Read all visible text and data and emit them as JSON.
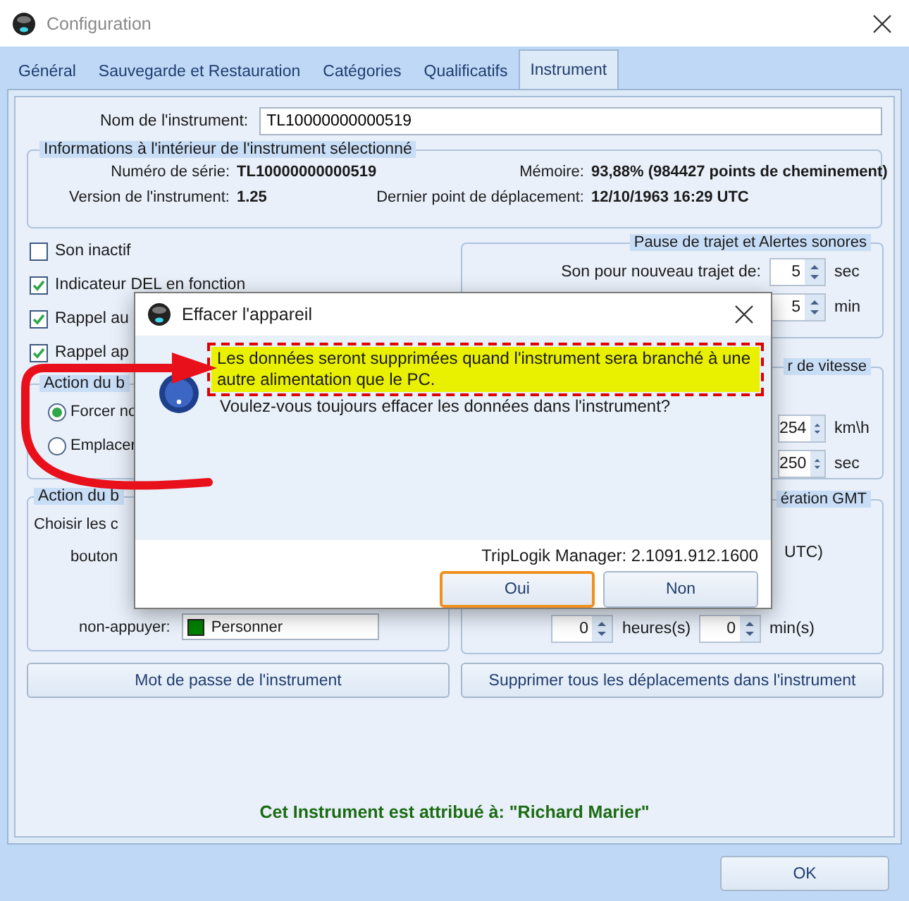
{
  "window": {
    "title": "Configuration"
  },
  "tabs": [
    {
      "label": "Général",
      "selected": false
    },
    {
      "label": "Sauvegarde et Restauration",
      "selected": false
    },
    {
      "label": "Catégories",
      "selected": false
    },
    {
      "label": "Qualificatifs",
      "selected": false
    },
    {
      "label": "Instrument",
      "selected": true
    }
  ],
  "instrument_name": {
    "label": "Nom de l'instrument:",
    "value": "TL10000000000519"
  },
  "info_group": {
    "title": "Informations à l'intérieur de l'instrument sélectionné",
    "fields": [
      {
        "label": "Numéro de série:",
        "value": "TL10000000000519"
      },
      {
        "label": "Mémoire:",
        "value": "93,88% (984427 points de cheminement)"
      },
      {
        "label": "Version de l'instrument:",
        "value": "1.25"
      },
      {
        "label": "Dernier point de déplacement:",
        "value": "12/10/1963 16:29 UTC"
      }
    ]
  },
  "options": [
    {
      "label": "Son inactif",
      "checked": false
    },
    {
      "label": "Indicateur DEL en fonction",
      "checked": true
    },
    {
      "label": "Rappel au",
      "checked": true
    },
    {
      "label": "Rappel ap",
      "checked": true
    }
  ],
  "button_action_group": {
    "title": "Action du b",
    "radios": [
      {
        "label": "Forcer no",
        "selected": true
      },
      {
        "label": "Emplacer",
        "selected": false
      }
    ]
  },
  "color_action_group": {
    "title": "Action du b",
    "lines": [
      "Choisir les c",
      "bouton"
    ],
    "select_label": "non-appuyer:",
    "select_value": "Personner"
  },
  "pause_group": {
    "title": "Pause de trajet et Alertes sonores",
    "rows": [
      {
        "label": "Son pour nouveau trajet de:",
        "value": "5",
        "unit": "sec"
      },
      {
        "value": "5",
        "unit": "min"
      }
    ]
  },
  "speed_group": {
    "title": "r de vitesse",
    "rows": [
      {
        "value": "254",
        "unit": "km\\h"
      },
      {
        "value": "250",
        "unit": "sec"
      }
    ]
  },
  "gmt_group": {
    "title": "ération GMT",
    "note": "UTC)",
    "spinners": [
      {
        "value": "0",
        "unit": "heures(s)"
      },
      {
        "value": "0",
        "unit": "min(s)"
      }
    ]
  },
  "action_buttons": [
    "Mot de passe de l'instrument",
    "Supprimer tous les déplacements dans l'instrument"
  ],
  "assignment": "Cet Instrument est attribué à: \"Richard Marier\"",
  "ok_button": "OK",
  "dialog": {
    "title": "Effacer l'appareil",
    "warning": "Les données seront supprimées quand l'instrument sera branché à une autre alimentation que le PC.",
    "question": "Voulez-vous toujours effacer les données dans l'instrument?",
    "version": "TripLogik Manager: 2.1091.912.1600",
    "buttons": [
      {
        "label": "Oui",
        "focused": true
      },
      {
        "label": "Non",
        "focused": false
      }
    ]
  }
}
